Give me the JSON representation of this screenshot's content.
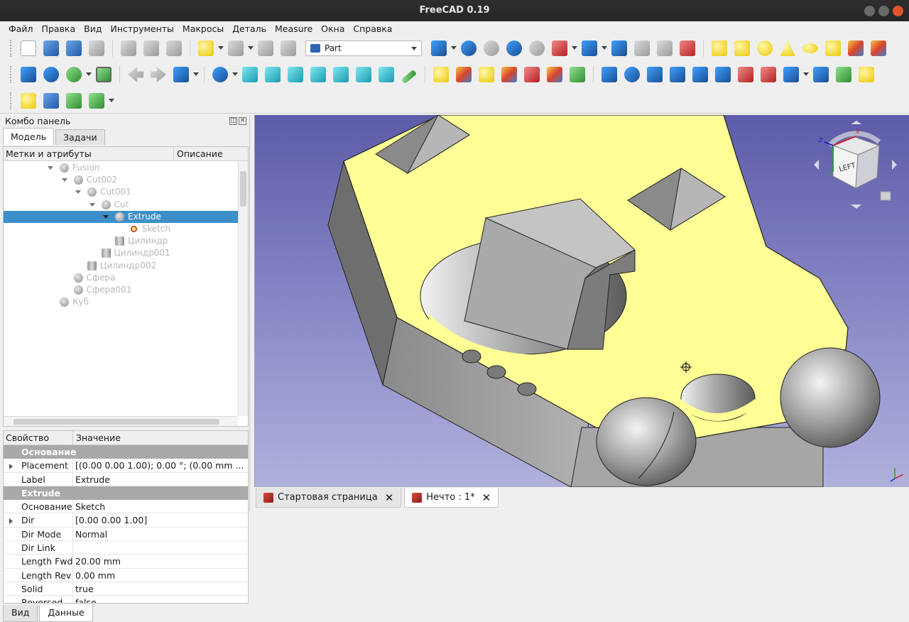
{
  "window": {
    "title": "FreeCAD 0.19"
  },
  "menu": [
    "Файл",
    "Правка",
    "Вид",
    "Инструменты",
    "Макросы",
    "Деталь",
    "Measure",
    "Окна",
    "Справка"
  ],
  "toolbar": {
    "workbench": "Part"
  },
  "combo_panel": {
    "title": "Комбо панель",
    "tabs": [
      "Модель",
      "Задачи"
    ],
    "tree_headers": [
      "Метки и атрибуты",
      "Описание"
    ],
    "tree": [
      {
        "label": "Fusion",
        "depth": 0,
        "expanded": true,
        "icon": "fusion-icon",
        "selected": false
      },
      {
        "label": "Cut002",
        "depth": 1,
        "expanded": true,
        "icon": "cut-icon",
        "selected": false
      },
      {
        "label": "Cut001",
        "depth": 2,
        "expanded": true,
        "icon": "cut-icon",
        "selected": false
      },
      {
        "label": "Cut",
        "depth": 3,
        "expanded": true,
        "icon": "cut-icon",
        "selected": false
      },
      {
        "label": "Extrude",
        "depth": 4,
        "expanded": true,
        "icon": "extrude-icon",
        "selected": true
      },
      {
        "label": "Sketch",
        "depth": 5,
        "expanded": false,
        "icon": "sketch-icon",
        "selected": false
      },
      {
        "label": "Цилиндр",
        "depth": 4,
        "expanded": false,
        "icon": "cylinder-icon",
        "selected": false
      },
      {
        "label": "Цилиндр001",
        "depth": 3,
        "expanded": false,
        "icon": "cylinder-icon",
        "selected": false
      },
      {
        "label": "Цилиндр002",
        "depth": 2,
        "expanded": false,
        "icon": "cylinder-icon",
        "selected": false
      },
      {
        "label": "Сфера",
        "depth": 1,
        "expanded": false,
        "icon": "sphere-icon",
        "selected": false
      },
      {
        "label": "Сфера001",
        "depth": 1,
        "expanded": false,
        "icon": "sphere-icon",
        "selected": false
      },
      {
        "label": "Куб",
        "depth": 0,
        "expanded": false,
        "icon": "box-icon",
        "selected": false
      }
    ],
    "prop_headers": [
      "Свойство",
      "Значение"
    ],
    "properties": [
      {
        "group": "Основание"
      },
      {
        "key": "Placement",
        "value": "[(0.00 0.00 1.00); 0.00 °; (0.00 mm ...",
        "expandable": true
      },
      {
        "key": "Label",
        "value": "Extrude"
      },
      {
        "group": "Extrude"
      },
      {
        "key": "Основание",
        "value": "Sketch"
      },
      {
        "key": "Dir",
        "value": "[0.00 0.00 1.00]",
        "expandable": true
      },
      {
        "key": "Dir Mode",
        "value": "Normal"
      },
      {
        "key": "Dir Link",
        "value": ""
      },
      {
        "key": "Length Fwd",
        "value": "20.00 mm"
      },
      {
        "key": "Length Rev",
        "value": "0.00 mm"
      },
      {
        "key": "Solid",
        "value": "true"
      },
      {
        "key": "Reversed",
        "value": "false"
      }
    ],
    "bottom_tabs": [
      "Вид",
      "Данные"
    ],
    "active_bottom_tab": "Данные"
  },
  "doc_tabs": [
    {
      "label": "Стартовая страница",
      "active": false
    },
    {
      "label": "Нечто : 1*",
      "active": true
    }
  ],
  "viewport": {
    "background_top": "#5c5ba8",
    "background_bottom": "#b1b1dc",
    "face_color": "#ffff96",
    "nav_cube_face": "LEFT",
    "axis_labels": [
      "X",
      "Y",
      "Z"
    ]
  }
}
